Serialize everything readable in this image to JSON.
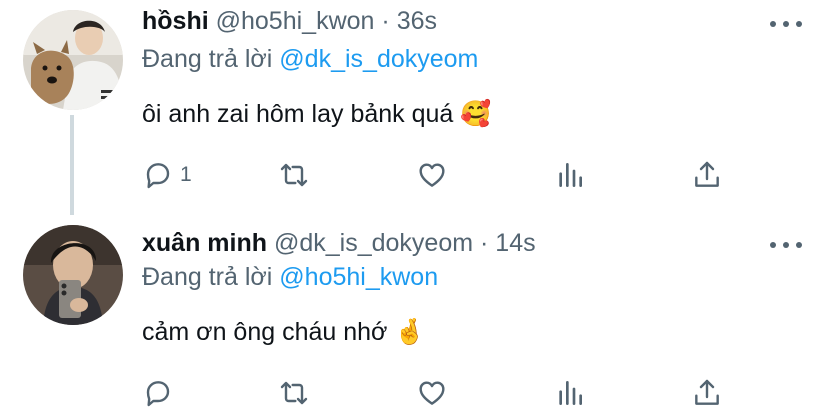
{
  "tweets": [
    {
      "name": "hồshi",
      "handle": "@ho5hi_kwon",
      "separator": "·",
      "time": "36s",
      "replying_prefix": "Đang trả lời",
      "replying_to": "@dk_is_dokyeom",
      "text": "ôi anh zai hôm lay bảnk quá 🥰",
      "reply_count": "1"
    },
    {
      "name": "xuân minh",
      "handle": "@dk_is_dokyeom",
      "separator": "·",
      "time": "14s",
      "replying_prefix": "Đang trả lời",
      "replying_to": "@ho5hi_kwon",
      "text": "cảm ơn ông cháu nhớ 🤞",
      "reply_count": ""
    }
  ],
  "icons": {
    "reply": "reply-icon",
    "retweet": "retweet-icon",
    "like": "heart-icon",
    "views": "views-icon",
    "share": "share-icon",
    "more": "more-icon"
  },
  "colors": {
    "link": "#1d9bf0",
    "secondary_text": "#536471",
    "thread_line": "#cfd9de"
  }
}
